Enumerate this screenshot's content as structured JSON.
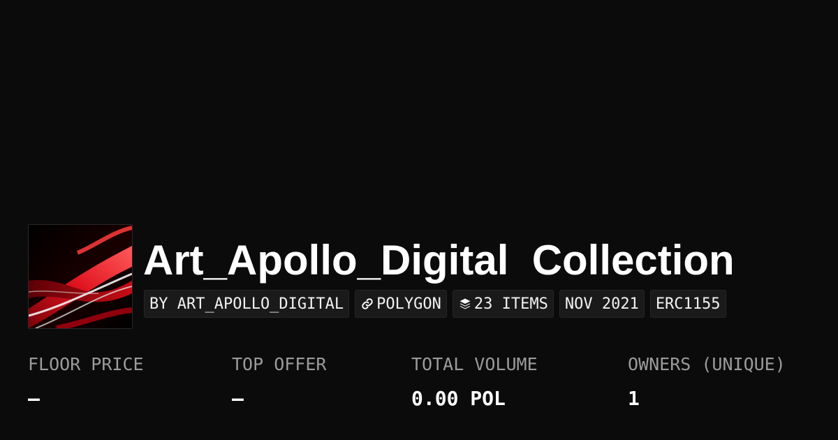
{
  "collection": {
    "title": "Art_Apollo_Digital  Collection",
    "tags": {
      "creator": "BY ART_APOLLO_DIGITAL",
      "chain": "POLYGON",
      "items": "23 ITEMS",
      "date": "NOV 2021",
      "standard": "ERC1155"
    },
    "icons": {
      "chain": "link-icon",
      "items": "layers-icon"
    }
  },
  "stats": {
    "floor_price": {
      "label": "FLOOR PRICE",
      "value": "–"
    },
    "top_offer": {
      "label": "TOP OFFER",
      "value": "–"
    },
    "total_volume": {
      "label": "TOTAL VOLUME",
      "value": "0.00 POL"
    },
    "owners": {
      "label": "OWNERS (UNIQUE)",
      "value": "1"
    }
  },
  "colors": {
    "background": "#0b0b0b",
    "tag_background": "#1a1a1a",
    "label_gray": "#9b9b9b",
    "artwork_red": "#d0101a"
  }
}
